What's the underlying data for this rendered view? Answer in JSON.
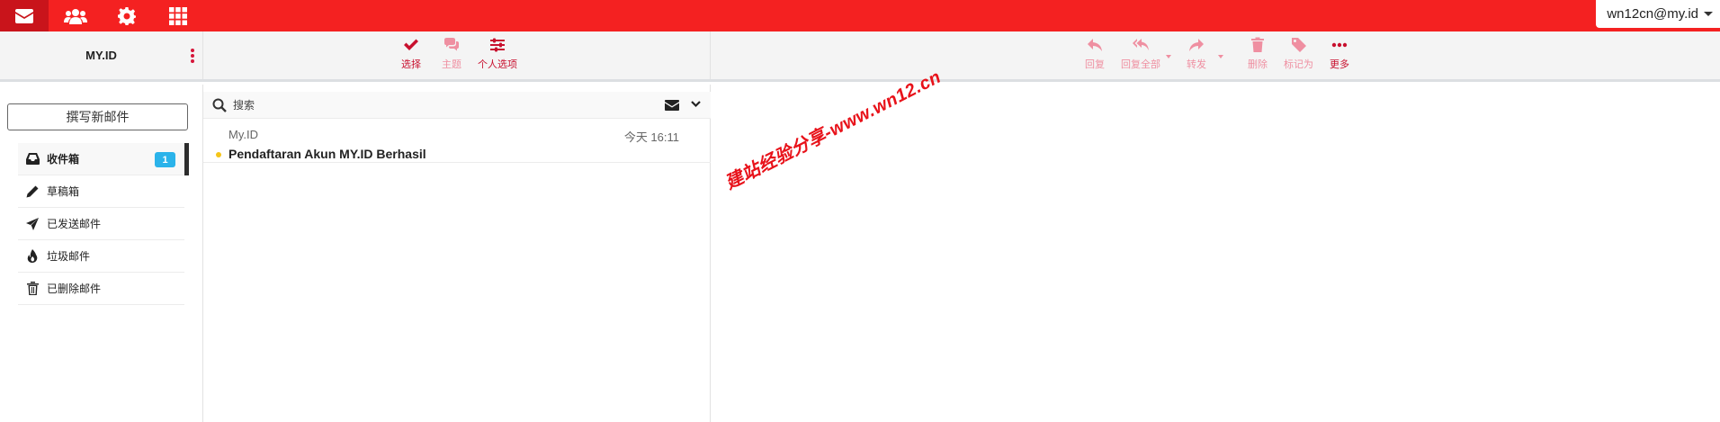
{
  "topnav": {
    "items": [
      {
        "icon": "mail-icon",
        "active": true
      },
      {
        "icon": "contacts-icon",
        "active": false
      },
      {
        "icon": "settings-icon",
        "active": false
      },
      {
        "icon": "apps-grid-icon",
        "active": false
      }
    ],
    "user_email": "wn12cn@my.id"
  },
  "left_header": {
    "title": "MY.ID"
  },
  "mid_toolbar": {
    "select_label": "选择",
    "threads_label": "主题",
    "options_label": "个人选项"
  },
  "message_toolbar": {
    "reply_label": "回复",
    "reply_all_label": "回复全部",
    "forward_label": "转发",
    "delete_label": "删除",
    "mark_label": "标记为",
    "more_label": "更多"
  },
  "sidebar": {
    "compose_label": "撰写新邮件",
    "folders": [
      {
        "label": "收件箱",
        "icon": "inbox-icon",
        "unread": "1",
        "active": true
      },
      {
        "label": "草稿箱",
        "icon": "pencil-icon",
        "active": false
      },
      {
        "label": "已发送邮件",
        "icon": "paper-plane-icon",
        "active": false
      },
      {
        "label": "垃圾邮件",
        "icon": "fire-icon",
        "active": false
      },
      {
        "label": "已删除邮件",
        "icon": "trash-icon",
        "active": false
      }
    ]
  },
  "message_list": {
    "search_placeholder": "搜索",
    "messages": [
      {
        "from": "My.ID",
        "date": "今天 16:11",
        "subject": "Pendaftaran Akun MY.ID Berhasil",
        "unread": true
      }
    ]
  },
  "watermark": {
    "text": "建站经验分享-www.wn12.cn"
  },
  "colors": {
    "brand_red": "#f42121",
    "active_nav": "#c9141b",
    "toolbar_red": "#c8102e",
    "toolbar_pink": "#ef8fa1",
    "badge_blue": "#2bb3ea",
    "unread_dot": "#f5c518"
  }
}
